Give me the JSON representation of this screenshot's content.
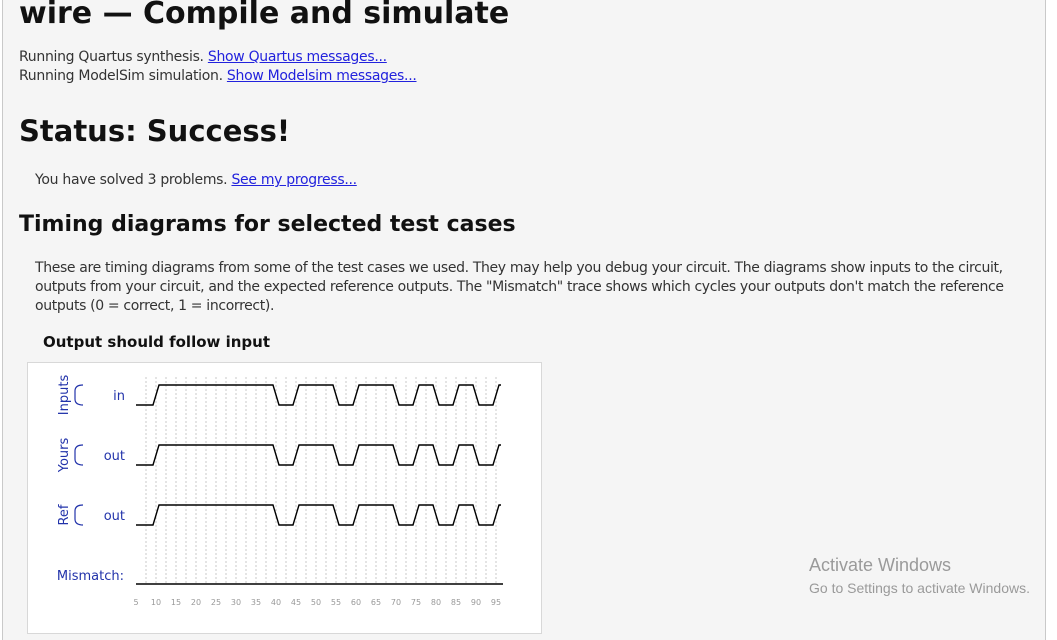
{
  "page": {
    "title": "wire — Compile and simulate",
    "quartus_text": "Running Quartus synthesis. ",
    "quartus_link": "Show Quartus messages...",
    "modelsim_text": "Running ModelSim simulation. ",
    "modelsim_link": "Show Modelsim messages...",
    "status": "Status: Success!",
    "solved_text": "You have solved 3 problems. ",
    "progress_link": "See my progress...",
    "timing_heading": "Timing diagrams for selected test cases",
    "timing_description": "These are timing diagrams from some of the test cases we used. They may help you debug your circuit. The diagrams show inputs to the circuit, outputs from your circuit, and the expected reference outputs. The \"Mismatch\" trace shows which cycles your outputs don't match the reference outputs (0 = correct, 1 = incorrect).",
    "case_title": "Output should follow input"
  },
  "timing_diagram": {
    "groups": [
      {
        "group": "Inputs",
        "signal": "in"
      },
      {
        "group": "Yours",
        "signal": "out"
      },
      {
        "group": "Ref",
        "signal": "out"
      }
    ],
    "mismatch_label": "Mismatch:",
    "transitions": [
      {
        "time": 5,
        "value": 0
      },
      {
        "time": 10,
        "value": 1
      },
      {
        "time": 40,
        "value": 0
      },
      {
        "time": 45,
        "value": 1
      },
      {
        "time": 55,
        "value": 0
      },
      {
        "time": 60,
        "value": 1
      },
      {
        "time": 70,
        "value": 0
      },
      {
        "time": 75,
        "value": 1
      },
      {
        "time": 80,
        "value": 0
      },
      {
        "time": 85,
        "value": 1
      },
      {
        "time": 90,
        "value": 0
      },
      {
        "time": 95,
        "value": 1
      }
    ],
    "time_range": [
      5,
      100
    ],
    "ticks": [
      "5",
      "10",
      "15",
      "20",
      "25",
      "30",
      "35",
      "40",
      "45",
      "50",
      "55",
      "60",
      "65",
      "70",
      "75",
      "80",
      "85",
      "90",
      "95"
    ],
    "colors": {
      "wave": "#000000",
      "label": "#2233aa",
      "grid": "#c8c8c8",
      "tick": "#999999"
    }
  },
  "watermark": {
    "line1": "Activate Windows",
    "line2": "Go to Settings to activate Windows."
  }
}
